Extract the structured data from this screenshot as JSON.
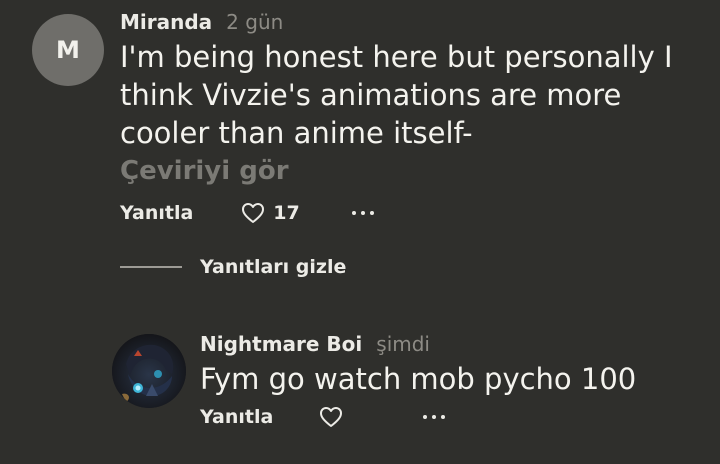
{
  "comment": {
    "avatar_letter": "M",
    "author": "Miranda",
    "time": "2 gün",
    "lines": [
      "I'm being honest here but personally I",
      "think Vivzie's animations are more",
      "cooler than anime itself-"
    ],
    "translate_label": "Çeviriyi gör",
    "reply_label": "Yanıtla",
    "like_count": "17"
  },
  "replies_toggle": {
    "label": "Yanıtları gizle"
  },
  "reply": {
    "author": "Nightmare Boi",
    "time": "şimdi",
    "text": "Fym go watch mob pycho 100",
    "reply_label": "Yanıtla"
  },
  "icons": {
    "like": "heart-outline-icon",
    "more": "more-dots-icon"
  },
  "colors": {
    "background": "#2f2f2c",
    "muted_text": "#8d8b85",
    "translate_text": "#7b7a75",
    "avatar_bg": "#6f6e6a"
  }
}
